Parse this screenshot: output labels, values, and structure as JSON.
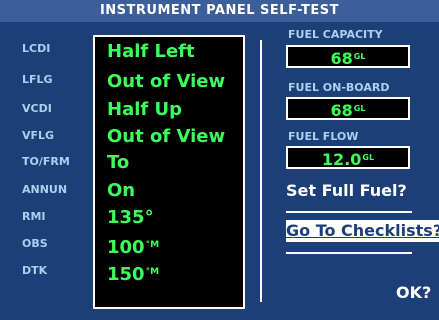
{
  "title": "INSTRUMENT PANEL SELF-TEST",
  "indicators": [
    {
      "label": "LCDI",
      "value": "Half Left",
      "unit": ""
    },
    {
      "label": "LFLG",
      "value": "Out of View",
      "unit": ""
    },
    {
      "label": "VCDI",
      "value": "Half Up",
      "unit": ""
    },
    {
      "label": "VFLG",
      "value": "Out of View",
      "unit": ""
    },
    {
      "label": "TO/FRM",
      "value": "To",
      "unit": ""
    },
    {
      "label": "ANNUN",
      "value": "On",
      "unit": ""
    },
    {
      "label": "RMI",
      "value": "135°",
      "unit": ""
    },
    {
      "label": "OBS",
      "value": "100",
      "unit": "°M"
    },
    {
      "label": "DTK",
      "value": "150",
      "unit": "°M"
    }
  ],
  "fuel": {
    "capacity": {
      "label": "FUEL CAPACITY",
      "value": "68",
      "unit": "GL"
    },
    "on_board": {
      "label": "FUEL ON-BOARD",
      "value": "68",
      "unit": "GL"
    },
    "flow": {
      "label": "FUEL FLOW",
      "value": "12.0",
      "unit": "GL"
    }
  },
  "actions": {
    "set_full_fuel": "Set Full Fuel?",
    "go_to_checklists": "Go To Checklists?",
    "ok": "OK?"
  },
  "colors": {
    "background": "#1c3f78",
    "title_bar": "#3a5f9a",
    "label": "#a9d2f0",
    "value": "#3dff5b"
  }
}
